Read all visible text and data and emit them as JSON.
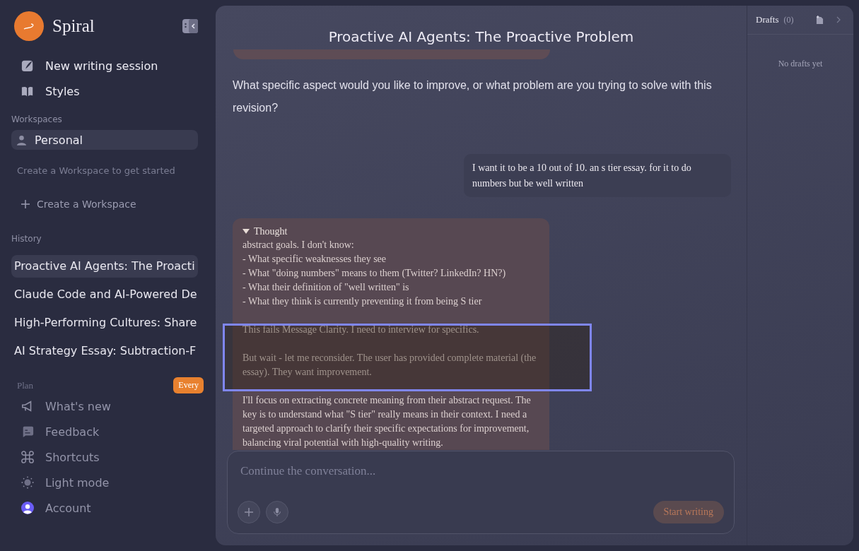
{
  "app": {
    "name": "Spiral"
  },
  "nav": [
    {
      "label": "New writing session"
    },
    {
      "label": "Styles"
    }
  ],
  "workspaces": {
    "heading": "Workspaces",
    "items": [
      {
        "label": "Personal",
        "selected": true
      }
    ],
    "hint": "Create a Workspace to get started",
    "create": "Create a Workspace"
  },
  "history": {
    "heading": "History",
    "items": [
      {
        "label": "Proactive AI Agents: The Proacti",
        "selected": true
      },
      {
        "label": "Claude Code and AI-Powered De",
        "selected": false
      },
      {
        "label": "High-Performing Cultures: Share",
        "selected": false
      },
      {
        "label": "AI Strategy Essay: Subtraction-F",
        "selected": false
      }
    ]
  },
  "plan": {
    "heading": "Plan",
    "badge": "Every"
  },
  "menu": [
    {
      "label": "What's new"
    },
    {
      "label": "Feedback"
    },
    {
      "label": "Shortcuts"
    },
    {
      "label": "Light mode"
    },
    {
      "label": "Account"
    }
  ],
  "chat": {
    "title": "Proactive AI Agents: The Proactive Problem",
    "messages": [
      {
        "kind": "stub"
      },
      {
        "kind": "assistant",
        "text": "What specific aspect would you like to improve, or what problem are you trying to solve with this revision?"
      },
      {
        "kind": "user",
        "text": "I want it to be a 10 out of 10. an s tier essay. for it to do numbers but be well written"
      },
      {
        "kind": "thought",
        "heading": "Thought",
        "expanded": true,
        "paragraphs": [
          [
            "abstract goals. I don't know:",
            "- What specific weaknesses they see",
            "- What \"doing numbers\" means to them (Twitter? LinkedIn? HN?)",
            "- What their definition of \"well written\" is",
            "- What they think is currently preventing it from being S tier"
          ],
          [
            "This fails Message Clarity. I need to interview for specifics."
          ],
          [
            "But wait - let me reconsider. The user has provided complete material (the essay). They want improvement."
          ],
          [
            "I'll focus on extracting concrete meaning from their abstract request. The key is to understand what \"S tier\" really means in their context. I need a targeted approach to clarify their specific expectations for improvement, balancing viral potential with high-quality writing."
          ]
        ]
      }
    ]
  },
  "composer": {
    "placeholder": "Continue the conversation...",
    "send": "Start writing"
  },
  "drafts": {
    "title": "Drafts",
    "count": "(0)",
    "empty": "No drafts yet"
  }
}
